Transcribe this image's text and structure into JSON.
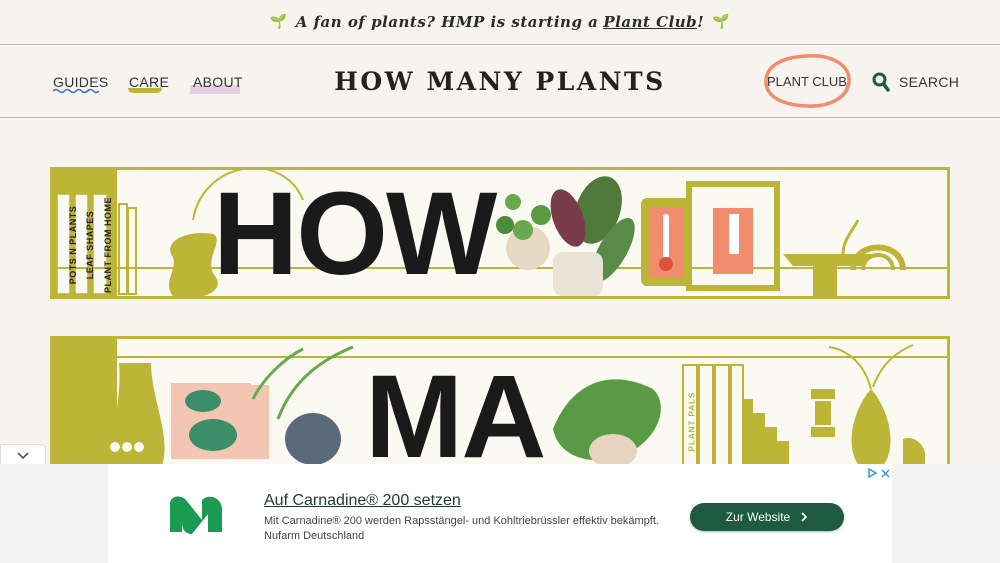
{
  "banner": {
    "text_before": "A fan of plants? HMP is starting a",
    "link_text": "Plant Club",
    "text_after": "!",
    "sprout_icon": "sprout-icon"
  },
  "nav": {
    "guides": "GUIDES",
    "care": "CARE",
    "about": "ABOUT",
    "logo": "HOW MANY PLANTS",
    "plant_club": "PLANT CLUB",
    "search": "SEARCH"
  },
  "hero": {
    "word1": "HOW",
    "word2": "MA",
    "books1": [
      "POTS N PLANTS",
      "LEAF SHAPES",
      "PLANT FROM HOME"
    ],
    "books2": [
      "PLANT PALS"
    ]
  },
  "ad": {
    "title": "Auf Carnadine® 200 setzen",
    "description": "Mit Carnadine® 200 werden Rapsstängel- und Kohltriebrüssler effektiv bekämpft.",
    "advertiser": "Nufarm Deutschland",
    "cta": "Zur Website"
  },
  "colors": {
    "accent_olive": "#bdb538",
    "club_ring": "#f28c6f",
    "search_icon": "#1e5a42",
    "ad_button": "#1e5a42"
  }
}
